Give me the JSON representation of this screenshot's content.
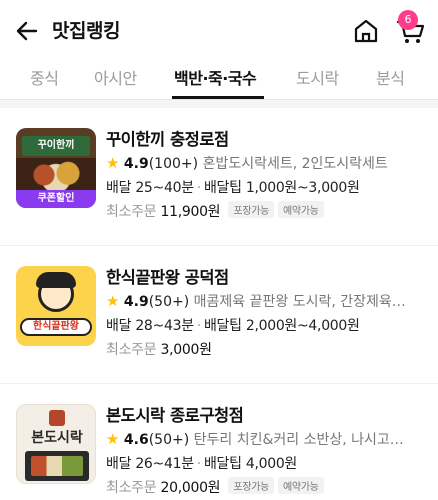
{
  "header": {
    "title": "맛집랭킹",
    "cart_count": "6"
  },
  "tabs": [
    {
      "label": "중식",
      "active": false
    },
    {
      "label": "아시안",
      "active": false
    },
    {
      "label": "백반·죽·국수",
      "active": true
    },
    {
      "label": "도시락",
      "active": false
    },
    {
      "label": "분식",
      "active": false
    }
  ],
  "restaurants": [
    {
      "name": "꾸이한끼 충정로점",
      "score": "4.9",
      "reviews": "(100+)",
      "menu": "혼밥도시락세트, 2인도시락세트",
      "delivery_label": "배달",
      "delivery_time": "25~40분",
      "tip_label": "배달팁",
      "tip": "1,000원~3,000원",
      "min_label": "최소주문",
      "min_order": "11,900원",
      "chips": [
        "포장가능",
        "예약가능"
      ],
      "thumb_text": "꾸이한끼",
      "coupon": "쿠폰할인"
    },
    {
      "name": "한식끝판왕 공덕점",
      "score": "4.9",
      "reviews": "(50+)",
      "menu": "매콤제육 끝판왕 도시락, 간장제육…",
      "delivery_label": "배달",
      "delivery_time": "28~43분",
      "tip_label": "배달팁",
      "tip": "2,000원~4,000원",
      "min_label": "최소주문",
      "min_order": "3,000원",
      "thumb_text": "한식끝판왕"
    },
    {
      "name": "본도시락 종로구청점",
      "score": "4.6",
      "reviews": "(50+)",
      "menu": "탄두리 치킨&커리 소반상, 나시고…",
      "delivery_label": "배달",
      "delivery_time": "26~41분",
      "tip_label": "배달팁",
      "tip": "4,000원",
      "min_label": "최소주문",
      "min_order": "20,000원",
      "chips": [
        "포장가능",
        "예약가능"
      ],
      "thumb_text": "본도시락"
    }
  ],
  "icons": {
    "back": "arrow-left-icon",
    "home": "home-icon",
    "cart": "cart-icon",
    "star": "star-icon"
  },
  "colors": {
    "badge": "#ff3d8b",
    "star": "#ffc107",
    "coupon": "#8a3bf0"
  }
}
